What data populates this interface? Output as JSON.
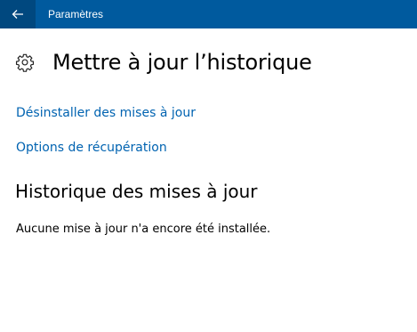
{
  "titlebar": {
    "app_title": "Paramètres",
    "back_icon": "arrow-left-icon",
    "background": "#005a9e"
  },
  "page": {
    "icon": "gear-icon",
    "title": "Mettre à jour l’historique"
  },
  "links": {
    "uninstall": "Désinstaller des mises à jour",
    "recovery": "Options de récupération",
    "color": "#0063b1"
  },
  "history": {
    "title": "Historique des mises à jour",
    "status": "Aucune mise à jour n'a encore été installée."
  }
}
